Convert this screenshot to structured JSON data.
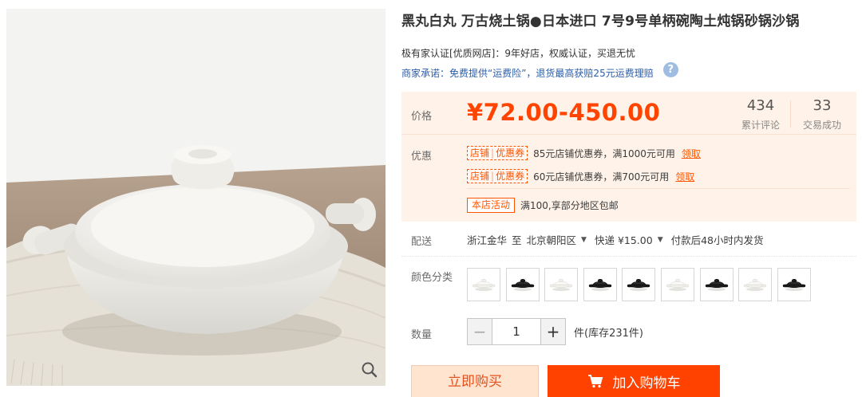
{
  "product": {
    "title": "黑丸白丸 万古烧土锅●日本进口 7号9号单柄碗陶土炖锅砂锅沙锅",
    "certification": "极有家认证[优质网店]：9年好店，权威认证，买退无忧",
    "promise": "商家承诺：免费提供“运费险”，退货最高获赔25元运费理赔",
    "help_icon": "?"
  },
  "price": {
    "label": "价格",
    "value": "¥72.00-450.00"
  },
  "stats": {
    "reviews_count": "434",
    "reviews_label": "累计评论",
    "trades_count": "33",
    "trades_label": "交易成功"
  },
  "promotions": {
    "label": "优惠",
    "coupons": [
      {
        "tag_left": "店铺",
        "tag_right": "优惠券",
        "text": "85元店铺优惠券，满1000元可用",
        "link": "领取"
      },
      {
        "tag_left": "店铺",
        "tag_right": "优惠券",
        "text": "60元店铺优惠券，满700元可用",
        "link": "领取"
      }
    ],
    "activity": {
      "tag": "本店活动",
      "text": "满100,享部分地区包邮"
    }
  },
  "shipping": {
    "label": "配送",
    "from": "浙江金华",
    "to_word": "至",
    "to": "北京朝阳区",
    "method": "快递 ¥15.00",
    "note": "付款后48小时内发货"
  },
  "color": {
    "label": "颜色分类",
    "swatches": [
      "white-pot",
      "black-pot",
      "white-pot",
      "black-pot",
      "black-pot",
      "white-pot",
      "black-pot",
      "white-pot",
      "black-pot"
    ]
  },
  "quantity": {
    "label": "数量",
    "minus": "−",
    "value": "1",
    "plus": "+",
    "stock": "件(库存231件)"
  },
  "actions": {
    "buy_now": "立即购买",
    "add_to_cart": "加入购物车"
  },
  "colors": {
    "accent": "#ff4400",
    "link": "#2a5ca8",
    "panel_bg": "#fff2e8"
  }
}
